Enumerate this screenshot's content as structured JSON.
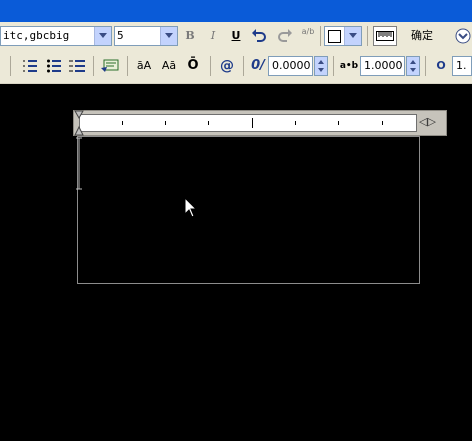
{
  "window": {
    "title_color": "#0a5bd8"
  },
  "toolbar": {
    "font_combo": {
      "value": "itc,gbcbig"
    },
    "height_combo": {
      "value": "5"
    },
    "bold_label": "B",
    "italic_label": "I",
    "underline_label": "U",
    "undo_icon": "undo-icon",
    "redo_icon": "redo-icon",
    "stack_label": "a/b",
    "color_combo": {
      "value": ""
    },
    "ok_label": "确定",
    "options_icon": "chevron-down-circle-icon",
    "numbering_icon": "numbered-list-icon",
    "bullets_icon": "bulleted-list-icon",
    "letters_icon": "lettered-list-icon",
    "insert_field_icon": "insert-field-icon",
    "uppercase_label": "āA",
    "lowercase_label": "Aā",
    "overline_label": "Ō",
    "symbol_label": "@",
    "oblique_label": "0/",
    "oblique_value": "0.0000",
    "tracking_label": "a•b",
    "tracking_value": "1.0000",
    "width_factor_label": "O",
    "width_factor_value": "1."
  },
  "editor": {
    "ruler_arrows": "◁▷"
  }
}
